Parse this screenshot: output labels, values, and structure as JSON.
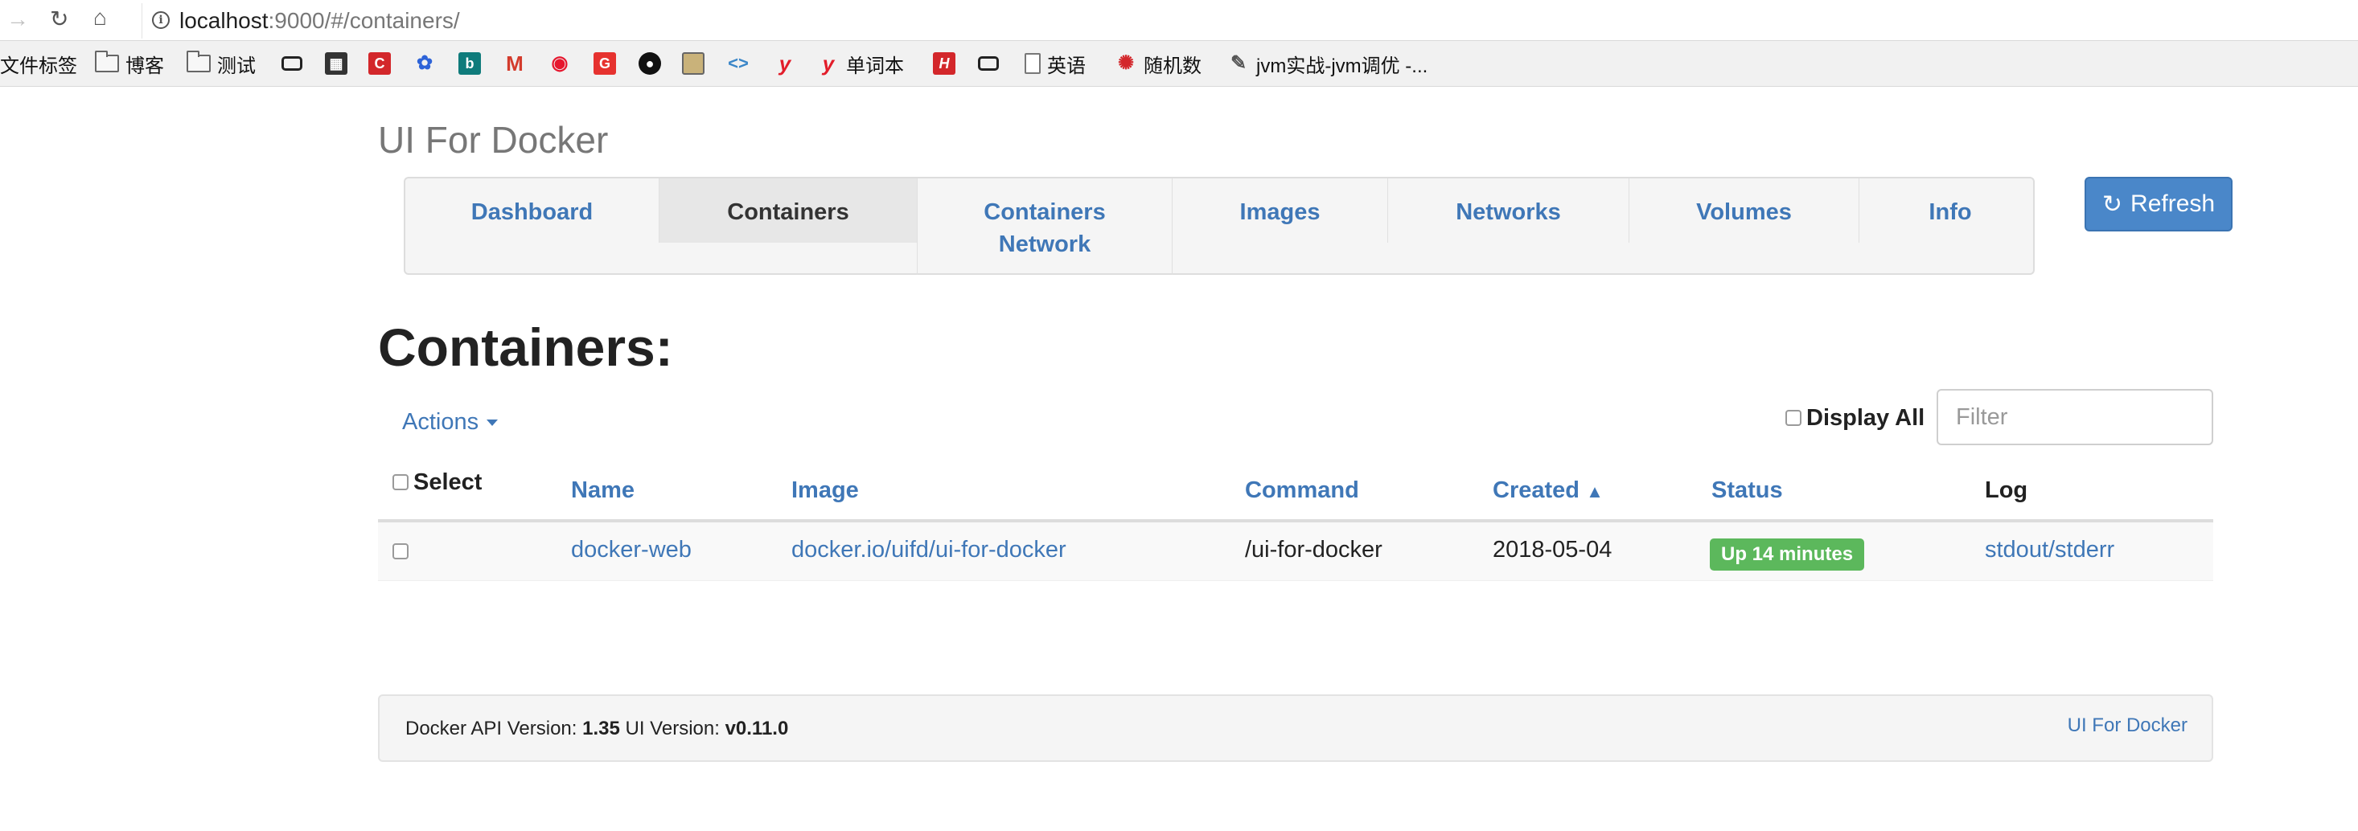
{
  "browser": {
    "url_host": "localhost",
    "url_rest": ":9000/#/containers/",
    "bookmarks": [
      {
        "label": "文件标签",
        "icon": "none"
      },
      {
        "label": "博客",
        "icon": "folder-icon"
      },
      {
        "label": "测试",
        "icon": "folder-icon"
      },
      {
        "label": "",
        "icon": "link-icon"
      },
      {
        "label": "",
        "icon": "qr-icon"
      },
      {
        "label": "",
        "icon": "red-c-icon"
      },
      {
        "label": "",
        "icon": "baidu-paw-icon"
      },
      {
        "label": "",
        "icon": "bing-icon"
      },
      {
        "label": "",
        "icon": "gmail-icon"
      },
      {
        "label": "",
        "icon": "weibo-icon"
      },
      {
        "label": "",
        "icon": "red-g-icon"
      },
      {
        "label": "",
        "icon": "github-icon"
      },
      {
        "label": "",
        "icon": "image-icon"
      },
      {
        "label": "",
        "icon": "code-icon"
      },
      {
        "label": "",
        "icon": "youdao-icon"
      },
      {
        "label": "单词本",
        "icon": "youdao-icon"
      },
      {
        "label": "",
        "icon": "red-h-icon"
      },
      {
        "label": "",
        "icon": "link-icon"
      },
      {
        "label": "英语",
        "icon": "page-icon"
      },
      {
        "label": "随机数",
        "icon": "random-icon"
      },
      {
        "label": "jvm实战-jvm调优 -...",
        "icon": "feather-icon"
      }
    ]
  },
  "app": {
    "title": "UI For Docker",
    "tabs": [
      {
        "label": "Dashboard",
        "active": false
      },
      {
        "label": "Containers",
        "active": true
      },
      {
        "label": "Containers",
        "label2": "Network",
        "active": false
      },
      {
        "label": "Images",
        "active": false
      },
      {
        "label": "Networks",
        "active": false
      },
      {
        "label": "Volumes",
        "active": false
      },
      {
        "label": "Info",
        "active": false
      }
    ],
    "refresh_label": "Refresh",
    "refresh_icon": "refresh-icon"
  },
  "containers": {
    "heading": "Containers:",
    "actions_label": "Actions",
    "display_all_label": "Display All",
    "filter_placeholder": "Filter",
    "columns": {
      "select": "Select",
      "name": "Name",
      "image": "Image",
      "command": "Command",
      "created": "Created",
      "status": "Status",
      "log": "Log"
    },
    "sort_indicator": "chevron-up-icon",
    "rows": [
      {
        "name": "docker-web",
        "image": "docker.io/uifd/ui-for-docker",
        "command": "/ui-for-docker",
        "created": "2018-05-04",
        "status": "Up 14 minutes",
        "log": "stdout/stderr"
      }
    ]
  },
  "footer": {
    "api_label": "Docker API Version:",
    "api_version": "1.35",
    "ui_label": "UI Version:",
    "ui_version": "v0.11.0",
    "link": "UI For Docker"
  },
  "colors": {
    "link": "#3f77b7",
    "refresh_button": "#4a87c9",
    "status_badge": "#5cb85c"
  }
}
